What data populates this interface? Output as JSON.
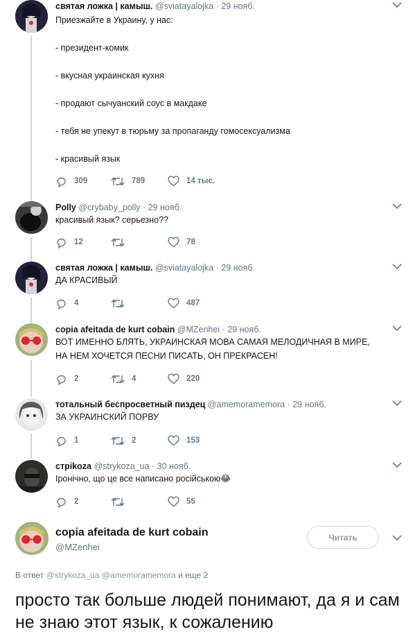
{
  "tweets": [
    {
      "name": "святая ложка | камыш.",
      "handle": "@sviatayalojka",
      "date": "· 29 нояб.",
      "text": "Приезжайте в Украину, у нас:\n\n- президент-комик\n\n- вкусная украинская кухня\n\n- продают сычуанский соус в макдаке\n\n- тебя не упекут в тюрьму за пропаганду гомосексуализма\n\n- красивый язык",
      "replies": "309",
      "retweets": "789",
      "likes": "14 тыс."
    },
    {
      "name": "Polly",
      "handle": "@crybaby_polly",
      "date": "· 29 нояб.",
      "text": "красивый язык? серьезно??",
      "replies": "12",
      "retweets": "",
      "likes": "78"
    },
    {
      "name": "святая ложка | камыш.",
      "handle": "@sviatayalojka",
      "date": "· 29 нояб.",
      "text": "ДА КРАСИВЫЙ",
      "replies": "4",
      "retweets": "",
      "likes": "487"
    },
    {
      "name": "copia afeitada de kurt cobain",
      "handle": "@MZenhei",
      "date": "· 29 нояб.",
      "text": "ВОТ ИМЕННО БЛЯТЬ, УКРАИНСКАЯ МОВА САМАЯ МЕЛОДИЧНАЯ В МИРЕ,\nНА НЕМ ХОЧЕТСЯ ПЕСНИ ПИСАТЬ, ОН ПРЕКРАСЕН!",
      "replies": "2",
      "retweets": "4",
      "likes": "220"
    },
    {
      "name": "тотальный беспросветный пиздец",
      "handle": "@amemoramemora",
      "date": "· 29 нояб.",
      "text": "ЗА УКРАИНСКИЙ ПОРВУ",
      "replies": "1",
      "retweets": "2",
      "likes": "153"
    },
    {
      "name": "стрikoza",
      "handle": "@strykoza_ua",
      "date": "· 30 нояб.",
      "text": "Іронічно, що це все написано російською😂",
      "replies": "2",
      "retweets": "",
      "likes": "55"
    }
  ],
  "main": {
    "name": "copia afeitada de kurt cobain",
    "handle": "@MZenhei",
    "follow_label": "Читать",
    "reply_prefix": "В ответ",
    "reply_handles": "@strykoza_ua @amemoramemora",
    "reply_suffix": "и еще 2",
    "text": "просто так больше людей понимают, да я и сам не знаю этот язык, к сожалению"
  },
  "colors": {
    "text": "#14171a",
    "muted": "#657786",
    "border": "#ccd6dd"
  }
}
